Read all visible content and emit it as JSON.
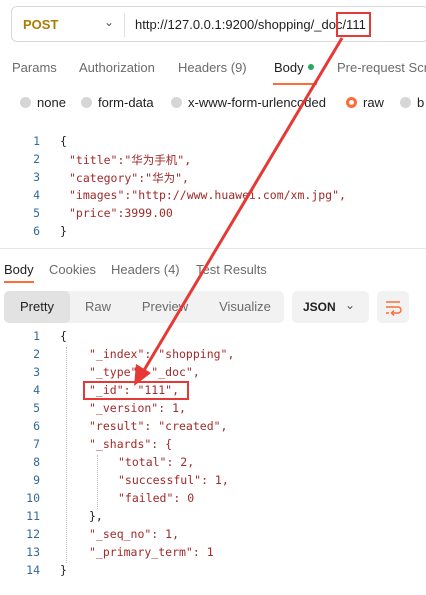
{
  "request": {
    "method": "POST",
    "url": "http://127.0.0.1:9200/shopping/_doc/111"
  },
  "request_tabs": [
    "Params",
    "Authorization",
    "Headers (9)",
    "Body",
    "Pre-request Scr"
  ],
  "body_types": [
    "none",
    "form-data",
    "x-www-form-urlencoded",
    "raw",
    "b"
  ],
  "request_body": {
    "line_numbers": [
      "1",
      "2",
      "3",
      "4",
      "5",
      "6"
    ],
    "lines": [
      "{",
      "\"title\":\"华为手机\",",
      "\"category\":\"华为\",",
      "\"images\":\"http://www.huawei.com/xm.jpg\",",
      "\"price\":3999.00",
      "}"
    ]
  },
  "response_tabs": [
    "Body",
    "Cookies",
    "Headers (4)",
    "Test Results"
  ],
  "view_modes": [
    "Pretty",
    "Raw",
    "Preview",
    "Visualize"
  ],
  "format": "JSON",
  "response_body": {
    "line_numbers": [
      "1",
      "2",
      "3",
      "4",
      "5",
      "6",
      "7",
      "8",
      "9",
      "10",
      "11",
      "12",
      "13",
      "14"
    ],
    "lines": [
      "{",
      "\"_index\": \"shopping\",",
      "\"_type\": \"_doc\",",
      "\"_id\": \"111\",",
      "\"_version\": 1,",
      "\"result\": \"created\",",
      "\"_shards\": {",
      "\"total\": 2,",
      "\"successful\": 1,",
      "\"failed\": 0",
      "},",
      "\"_seq_no\": 1,",
      "\"_primary_term\": 1",
      "}"
    ]
  },
  "colors": {
    "accent": "#ff6c37",
    "annotation": "#e53935",
    "method": "#ad7a03"
  }
}
